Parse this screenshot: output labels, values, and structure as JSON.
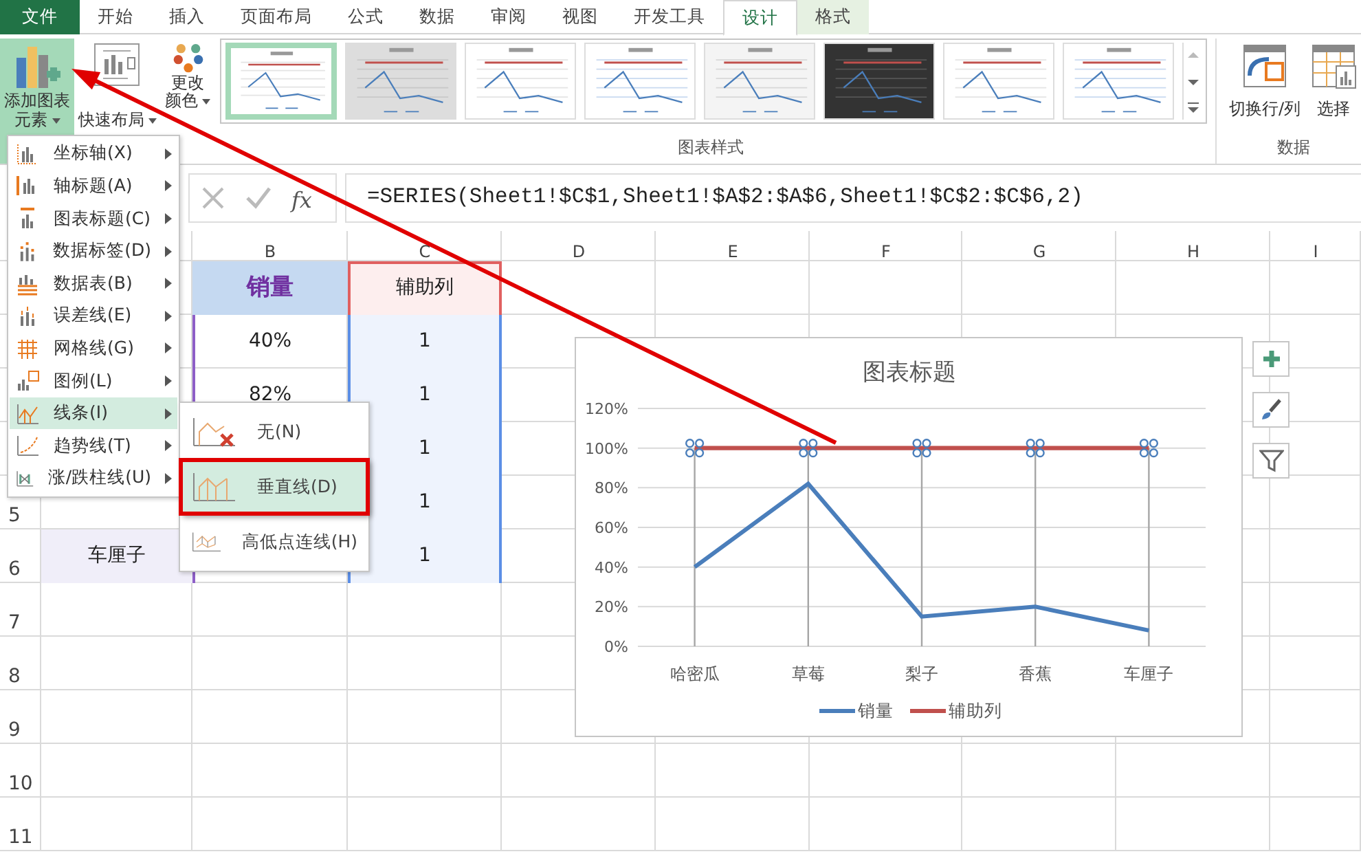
{
  "tabs": [
    {
      "label": "文件",
      "kind": "file",
      "selected": false
    },
    {
      "label": "开始",
      "kind": "normal",
      "selected": false
    },
    {
      "label": "插入",
      "kind": "normal",
      "selected": false
    },
    {
      "label": "页面布局",
      "kind": "normal",
      "selected": false
    },
    {
      "label": "公式",
      "kind": "normal",
      "selected": false
    },
    {
      "label": "数据",
      "kind": "normal",
      "selected": false
    },
    {
      "label": "审阅",
      "kind": "normal",
      "selected": false
    },
    {
      "label": "视图",
      "kind": "normal",
      "selected": false
    },
    {
      "label": "开发工具",
      "kind": "normal",
      "selected": false
    },
    {
      "label": "设计",
      "kind": "context",
      "selected": true
    },
    {
      "label": "格式",
      "kind": "context",
      "selected": false
    }
  ],
  "ribbon": {
    "chart_buttons": [
      {
        "kind": "add-element",
        "lines": [
          "添加图表",
          "元素"
        ],
        "dropdown": true,
        "selected": true
      },
      {
        "kind": "quick-layout",
        "lines": [
          "快速布局"
        ],
        "dropdown": true,
        "selected": false
      },
      {
        "kind": "colors",
        "lines": [
          "更改",
          "颜色"
        ],
        "dropdown": true,
        "selected": false
      }
    ],
    "styles": {
      "group_label": "图表样式",
      "thumbnails": [
        {
          "kind": "plain",
          "selected": true
        },
        {
          "kind": "gray",
          "selected": false
        },
        {
          "kind": "plain",
          "selected": false
        },
        {
          "kind": "band",
          "selected": false
        },
        {
          "kind": "hatch",
          "selected": false
        },
        {
          "kind": "dark",
          "selected": false
        },
        {
          "kind": "plain",
          "selected": false
        },
        {
          "kind": "band",
          "selected": false
        }
      ]
    },
    "data_group": {
      "group_label": "数据",
      "buttons": [
        {
          "kind": "switch",
          "label": "切换行/列"
        },
        {
          "kind": "select",
          "label": "选择"
        }
      ]
    }
  },
  "formula_bar": {
    "function_label": "fx",
    "formula": "=SERIES(Sheet1!$C$1,Sheet1!$A$2:$A$6,Sheet1!$C$2:$C$6,2)"
  },
  "sheet": {
    "columns": [
      "B",
      "C",
      "D",
      "E",
      "F",
      "G",
      "H",
      "I"
    ],
    "rows": [
      {
        "cells": {
          "B": "销量",
          "C": "辅助列"
        }
      },
      {
        "cells": {
          "B": "40%",
          "C": "1"
        }
      },
      {
        "cells": {
          "B": "82%",
          "C": "1"
        }
      },
      {
        "cells": {
          "C": "1"
        }
      },
      {
        "number": "5",
        "cells": {
          "C": "1"
        }
      },
      {
        "number": "6",
        "cells": {
          "A": "车厘子",
          "C": "1"
        }
      },
      {
        "number": "7"
      },
      {
        "number": "8"
      },
      {
        "number": "9"
      },
      {
        "number": "10"
      },
      {
        "number": "11"
      }
    ]
  },
  "menu": {
    "items": [
      {
        "label": "坐标轴(X)",
        "kind": "axis",
        "selected": false
      },
      {
        "label": "轴标题(A)",
        "kind": "axis-title",
        "selected": false
      },
      {
        "label": "图表标题(C)",
        "kind": "chart-title",
        "selected": false
      },
      {
        "label": "数据标签(D)",
        "kind": "data-label",
        "selected": false
      },
      {
        "label": "数据表(B)",
        "kind": "data-table",
        "selected": false
      },
      {
        "label": "误差线(E)",
        "kind": "error-bar",
        "selected": false
      },
      {
        "label": "网格线(G)",
        "kind": "gridline",
        "selected": false
      },
      {
        "label": "图例(L)",
        "kind": "legend",
        "selected": false
      },
      {
        "label": "线条(I)",
        "kind": "lines",
        "selected": true
      },
      {
        "label": "趋势线(T)",
        "kind": "trendline",
        "selected": false
      },
      {
        "label": "涨/跌柱线(U)",
        "kind": "updown",
        "selected": false
      }
    ]
  },
  "submenu": {
    "items": [
      {
        "label": "无(N)",
        "kind": "none",
        "selected": false,
        "annotated": false
      },
      {
        "label": "垂直线(D)",
        "kind": "drop",
        "selected": true,
        "annotated": true
      },
      {
        "label": "高低点连线(H)",
        "kind": "highlow",
        "selected": false,
        "annotated": false
      }
    ]
  },
  "chart": {
    "drop_lines": true,
    "series_selected": [
      false,
      true
    ],
    "chart_data": {
      "type": "line",
      "title": "图表标题",
      "categories": [
        "哈密瓜",
        "草莓",
        "梨子",
        "香蕉",
        "车厘子"
      ],
      "series": [
        {
          "name": "销量",
          "color": "#4a7ebb",
          "values": [
            0.4,
            0.82,
            0.15,
            0.2,
            0.08
          ]
        },
        {
          "name": "辅助列",
          "color": "#c0504d",
          "values": [
            1,
            1,
            1,
            1,
            1
          ]
        }
      ],
      "ylim": [
        0,
        1.2
      ],
      "yticks": [
        {
          "value": 0,
          "label": "0%"
        },
        {
          "value": 0.2,
          "label": "20%"
        },
        {
          "value": 0.4,
          "label": "40%"
        },
        {
          "value": 0.6,
          "label": "60%"
        },
        {
          "value": 0.8,
          "label": "80%"
        },
        {
          "value": 1,
          "label": "100%"
        },
        {
          "value": 1.2,
          "label": "120%"
        }
      ],
      "grid": true,
      "legend": "bottom"
    }
  }
}
